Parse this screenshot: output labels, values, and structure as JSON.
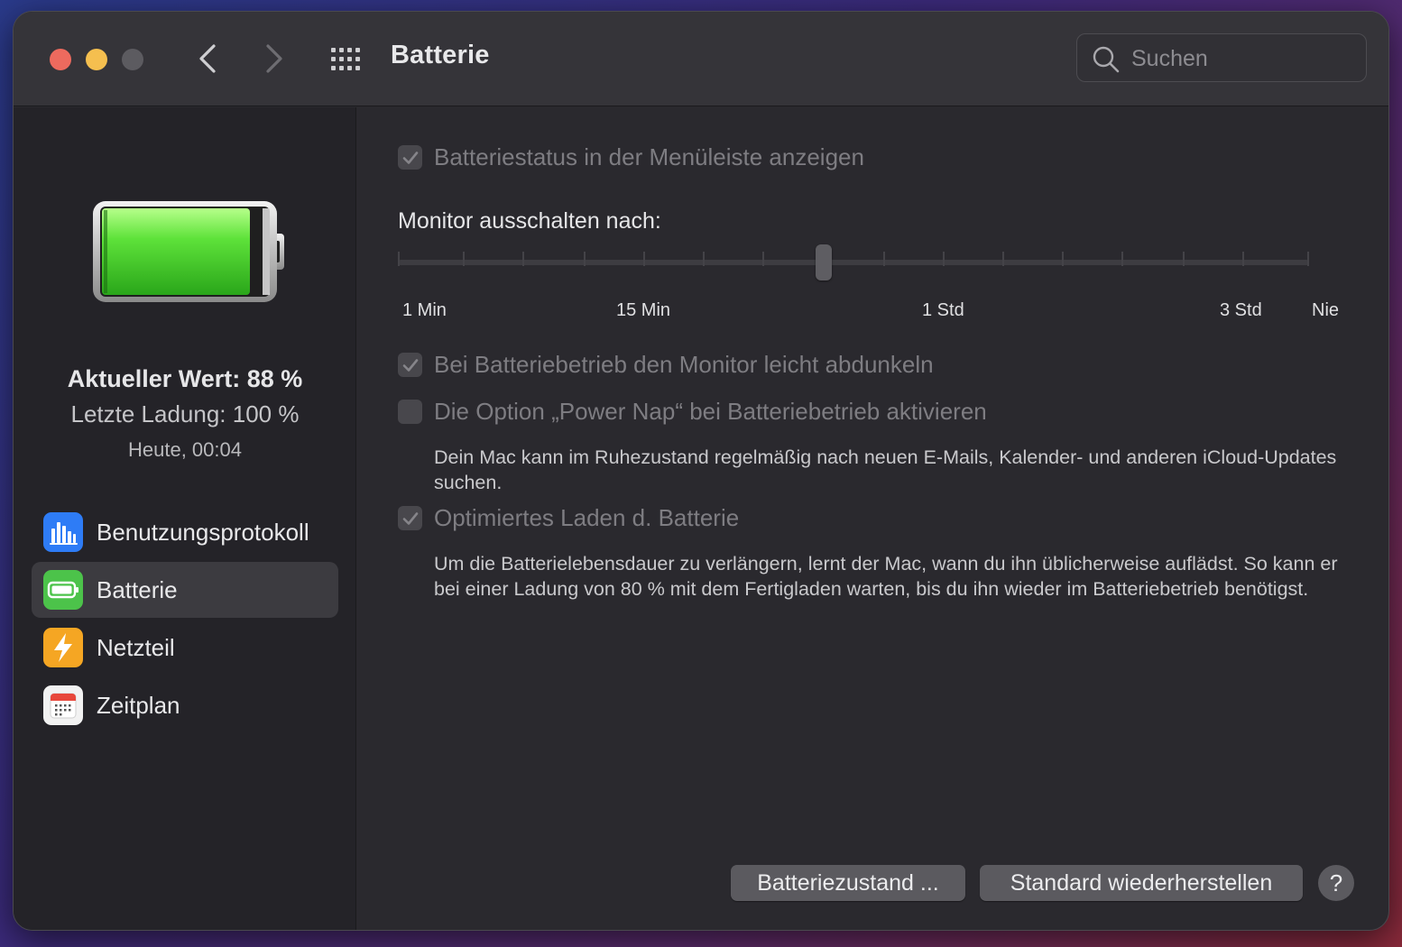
{
  "window": {
    "title": "Batterie",
    "search_placeholder": "Suchen"
  },
  "sidebar": {
    "status": {
      "current": "Aktueller Wert: 88 %",
      "last_charge": "Letzte Ladung: 100 %",
      "time": "Heute, 00:04"
    },
    "battery_level": 0.88,
    "items": [
      {
        "label": "Benutzungsprotokoll",
        "icon": "bar-chart-icon",
        "color": "#2e7cf6"
      },
      {
        "label": "Batterie",
        "icon": "battery-icon",
        "color": "#4cc34a",
        "selected": true
      },
      {
        "label": "Netzteil",
        "icon": "lightning-icon",
        "color": "#f5a623"
      },
      {
        "label": "Zeitplan",
        "icon": "calendar-icon",
        "color": "#f2f2f2"
      }
    ]
  },
  "content": {
    "menu_status": {
      "label": "Batteriestatus in der Menüleiste anzeigen",
      "checked": true
    },
    "slider": {
      "title": "Monitor ausschalten nach:",
      "labels": [
        "1 Min",
        "15 Min",
        "1 Std",
        "3 Std",
        "Nie"
      ],
      "value": "1 Std"
    },
    "dim_display": {
      "label": "Bei Batteriebetrieb den Monitor leicht abdunkeln",
      "checked": true
    },
    "power_nap": {
      "label": "Die Option „Power Nap“ bei Batteriebetrieb aktivieren",
      "checked": false,
      "description": "Dein Mac kann im Ruhezustand regelmäßig nach neuen E-Mails, Kalender- und anderen iCloud-Updates suchen."
    },
    "optimized_charging": {
      "label": "Optimiertes Laden d. Batterie",
      "checked": true,
      "description": "Um die Batterielebensdauer zu verlängern, lernt der Mac, wann du ihn üblicherweise auflädst. So kann er bei einer Ladung von 80 % mit dem Fertigladen warten, bis du ihn wieder im Batteriebetrieb benötigst."
    }
  },
  "buttons": {
    "battery_health": "Batteriezustand ...",
    "restore_defaults": "Standard wiederherstellen",
    "help": "?"
  }
}
